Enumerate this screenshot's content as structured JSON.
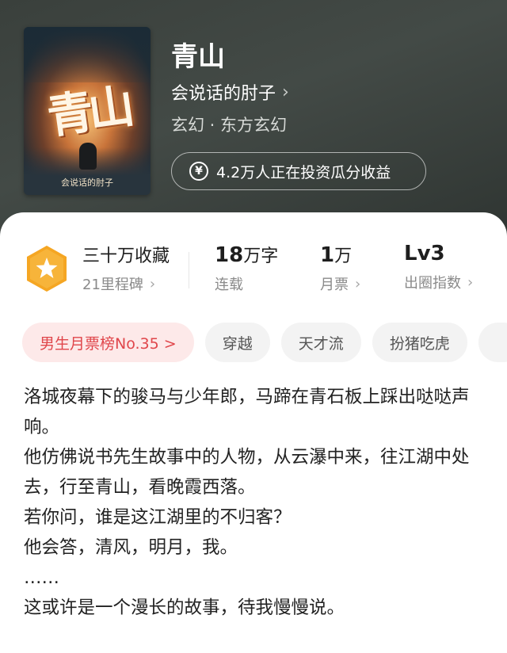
{
  "book": {
    "title": "青山",
    "author": "会说话的肘子",
    "genre": "玄幻 · 东方玄幻",
    "cover": {
      "title_art": "青山",
      "author_art": "会说话的肘子"
    },
    "invest_label": "4.2万人正在投资瓜分收益"
  },
  "stats": {
    "favorites": {
      "main": "三十万收藏",
      "sub": "21里程碑"
    },
    "words": {
      "value": "18",
      "unit": "万字",
      "sub": "连载"
    },
    "tickets": {
      "value": "1",
      "unit": "万",
      "sub": "月票"
    },
    "index": {
      "value": "Lv3",
      "sub": "出圈指数"
    }
  },
  "tags": [
    "男生月票榜No.35 >",
    "穿越",
    "天才流",
    "扮猪吃虎"
  ],
  "description": [
    "洛城夜幕下的骏马与少年郎，马蹄在青石板上踩出哒哒声响。",
    "他仿佛说书先生故事中的人物，从云瀑中来，往江湖中处去，行至青山，看晚霞西落。",
    "若你问，谁是这江湖里的不归客？",
    "他会答，清风，明月，我。",
    "……",
    "这或许是一个漫长的故事，待我慢慢说。"
  ],
  "colors": {
    "accent_red": "#e0464b",
    "badge_orange": "#f5a623",
    "header_bg": "#3d4340"
  },
  "icons": {
    "chevron": "›",
    "yen": "¥"
  }
}
